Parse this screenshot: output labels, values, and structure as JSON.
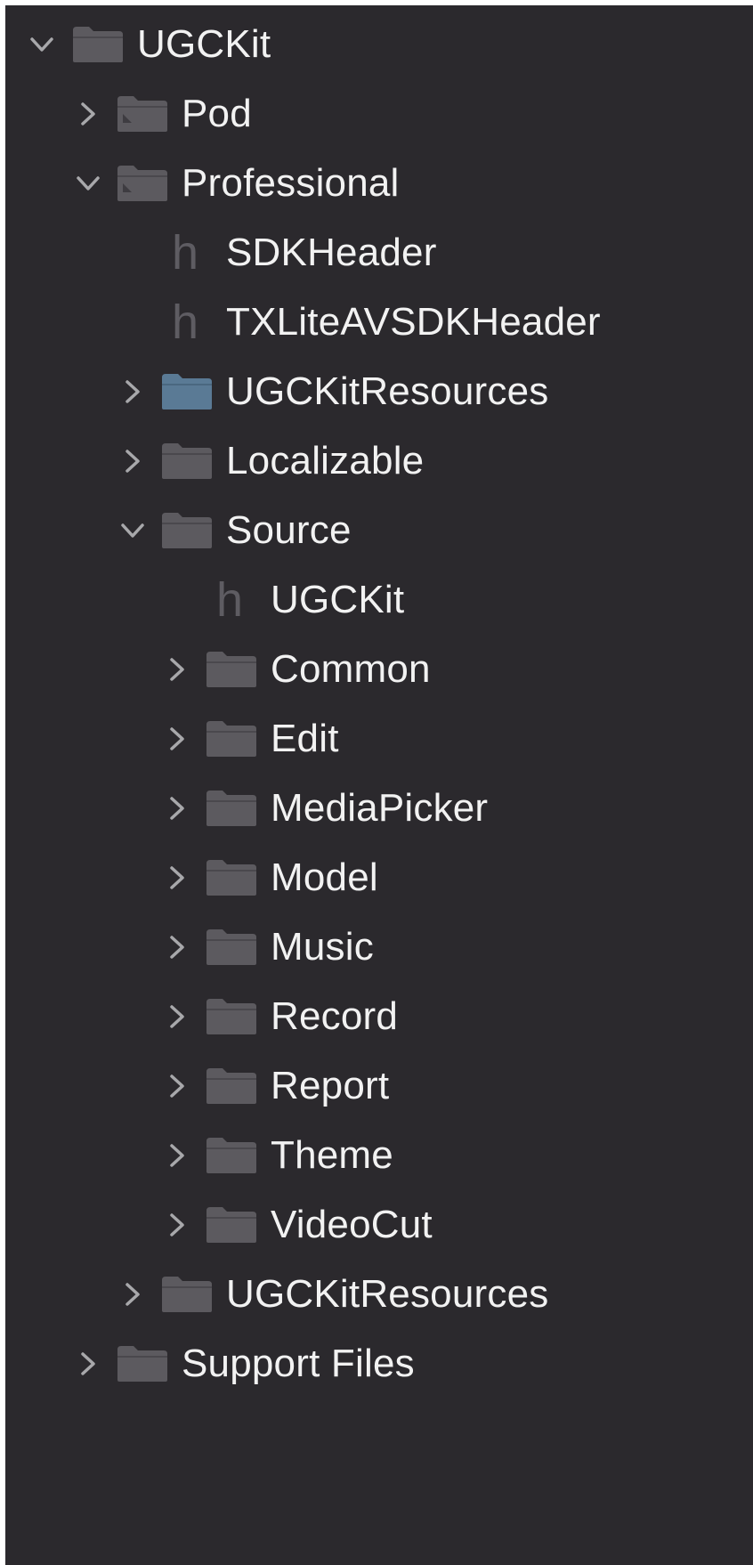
{
  "navigator": {
    "items": [
      {
        "label": "UGCKit",
        "expanded": true,
        "icon": "folder-icon"
      },
      {
        "label": "Pod",
        "expanded": false,
        "icon": "group-folder-icon"
      },
      {
        "label": "Professional",
        "expanded": true,
        "icon": "group-folder-icon"
      },
      {
        "label": "SDKHeader",
        "icon": "header-file-icon",
        "icon_glyph": "h"
      },
      {
        "label": "TXLiteAVSDKHeader",
        "icon": "header-file-icon",
        "icon_glyph": "h"
      },
      {
        "label": "UGCKitResources",
        "expanded": false,
        "icon": "blue-folder-icon"
      },
      {
        "label": "Localizable",
        "expanded": false,
        "icon": "folder-icon"
      },
      {
        "label": "Source",
        "expanded": true,
        "icon": "folder-icon"
      },
      {
        "label": "UGCKit",
        "icon": "header-file-icon",
        "icon_glyph": "h"
      },
      {
        "label": "Common",
        "expanded": false,
        "icon": "folder-icon"
      },
      {
        "label": "Edit",
        "expanded": false,
        "icon": "folder-icon"
      },
      {
        "label": "MediaPicker",
        "expanded": false,
        "icon": "folder-icon"
      },
      {
        "label": "Model",
        "expanded": false,
        "icon": "folder-icon"
      },
      {
        "label": "Music",
        "expanded": false,
        "icon": "folder-icon"
      },
      {
        "label": "Record",
        "expanded": false,
        "icon": "folder-icon"
      },
      {
        "label": "Report",
        "expanded": false,
        "icon": "folder-icon"
      },
      {
        "label": "Theme",
        "expanded": false,
        "icon": "folder-icon"
      },
      {
        "label": "VideoCut",
        "expanded": false,
        "icon": "folder-icon"
      },
      {
        "label": "UGCKitResources",
        "expanded": false,
        "icon": "folder-icon"
      },
      {
        "label": "Support Files",
        "expanded": false,
        "icon": "folder-icon"
      }
    ]
  },
  "colors": {
    "background": "#2b292d",
    "text": "#f2f2f2",
    "folder": "#5c5a5f",
    "blue_folder": "#5a7a95",
    "chevron": "#a8a8ab",
    "header_glyph": "#5e5c62"
  }
}
